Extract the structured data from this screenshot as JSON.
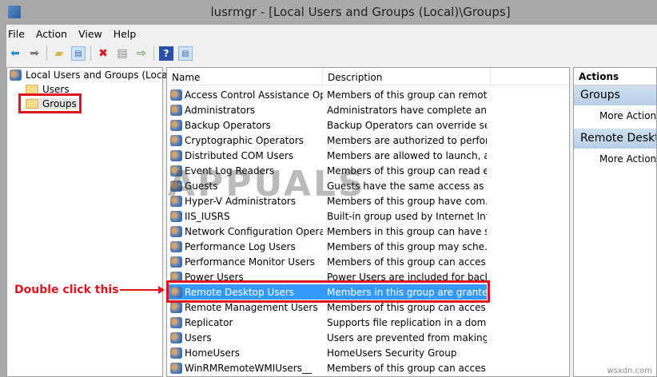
{
  "window": {
    "title": "lusrmgr - [Local Users and Groups (Local)\\Groups]"
  },
  "menu": [
    "File",
    "Action",
    "View",
    "Help"
  ],
  "toolbar": {
    "icons": [
      "back-icon",
      "forward-icon",
      "up-folder-icon",
      "show-hide-tree-icon",
      "delete-icon",
      "properties-icon",
      "export-icon",
      "help-icon",
      "show-hide-action-pane-icon"
    ]
  },
  "tree": {
    "root": "Local Users and Groups (Local)",
    "children": [
      "Users",
      "Groups"
    ]
  },
  "list": {
    "columns": [
      "Name",
      "Description"
    ],
    "rows": [
      {
        "name": "Access Control Assistance Op...",
        "desc": "Members of this group can remot..."
      },
      {
        "name": "Administrators",
        "desc": "Administrators have complete an..."
      },
      {
        "name": "Backup Operators",
        "desc": "Backup Operators can override se..."
      },
      {
        "name": "Cryptographic Operators",
        "desc": "Members are authorized to perfor..."
      },
      {
        "name": "Distributed COM Users",
        "desc": "Members are allowed to launch, a..."
      },
      {
        "name": "Event Log Readers",
        "desc": "Members of this group can read e..."
      },
      {
        "name": "Guests",
        "desc": "Guests have the same access as m..."
      },
      {
        "name": "Hyper-V Administrators",
        "desc": "Members of this group have com..."
      },
      {
        "name": "IIS_IUSRS",
        "desc": "Built-in group used by Internet Inf..."
      },
      {
        "name": "Network Configuration Operat...",
        "desc": "Members in this group can have s..."
      },
      {
        "name": "Performance Log Users",
        "desc": "Members of this group may sche..."
      },
      {
        "name": "Performance Monitor Users",
        "desc": "Members of this group can acces..."
      },
      {
        "name": "Power Users",
        "desc": "Power Users are included for back..."
      },
      {
        "name": "Remote Desktop Users",
        "desc": "Members in this group are grante..."
      },
      {
        "name": "Remote Management Users",
        "desc": "Members of this group can acces..."
      },
      {
        "name": "Replicator",
        "desc": "Supports file replication in a dom..."
      },
      {
        "name": "Users",
        "desc": "Users are prevented from making ..."
      },
      {
        "name": "HomeUsers",
        "desc": "HomeUsers Security Group"
      },
      {
        "name": "WinRMRemoteWMIUsers__",
        "desc": "Members of this group can acces..."
      }
    ],
    "selected_index": 13
  },
  "actions": {
    "header": "Actions",
    "sections": [
      {
        "title": "Groups",
        "item": "More Actions"
      },
      {
        "title": "Remote Desktop Users",
        "item": "More Actions"
      }
    ]
  },
  "annotation": "Double click this",
  "watermark": "APPUALS",
  "credit": "wsxdn.com"
}
